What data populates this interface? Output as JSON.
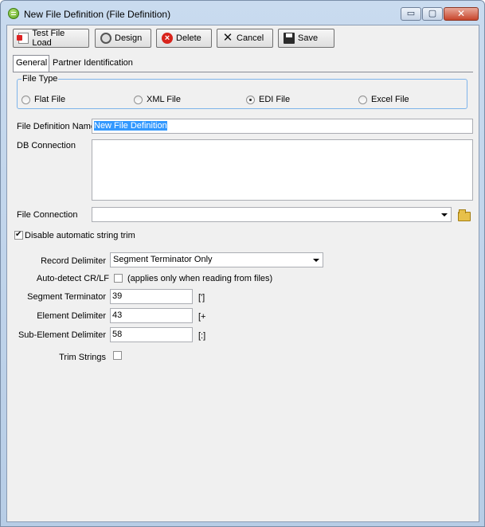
{
  "window": {
    "title": "New File Definition (File Definition)",
    "controls": {
      "minimize": "▭",
      "maximize": "▢",
      "close": "✕"
    }
  },
  "toolbar": {
    "test_file_load": "Test File Load",
    "design": "Design",
    "delete": "Delete",
    "cancel": "Cancel",
    "save": "Save"
  },
  "tabs": [
    "General",
    "Partner Identification"
  ],
  "file_type": {
    "label": "File Type",
    "options": [
      "Flat File",
      "XML File",
      "EDI File",
      "Excel File"
    ],
    "selected": "EDI File"
  },
  "form": {
    "file_definition_name_label": "File Definition Name",
    "file_definition_name_value": "New File Definition",
    "db_connection_label": "DB Connection",
    "file_connection_label": "File Connection",
    "file_connection_value": "",
    "disable_trim_label": "Disable automatic string trim",
    "disable_trim_checked": true,
    "record_delimiter_label": "Record Delimiter",
    "record_delimiter_value": "Segment Terminator Only",
    "auto_detect_label": "Auto-detect CR/LF",
    "auto_detect_note": "(applies only when reading from files)",
    "auto_detect_checked": false,
    "segment_terminator_label": "Segment Terminator",
    "segment_terminator_value": "39",
    "segment_terminator_char": "[']",
    "element_delimiter_label": "Element Delimiter",
    "element_delimiter_value": "43",
    "element_delimiter_char": "[+",
    "sub_element_delimiter_label": "Sub-Element Delimiter",
    "sub_element_delimiter_value": "58",
    "sub_element_delimiter_char": "[:]",
    "trim_strings_label": "Trim Strings",
    "trim_strings_checked": false
  }
}
